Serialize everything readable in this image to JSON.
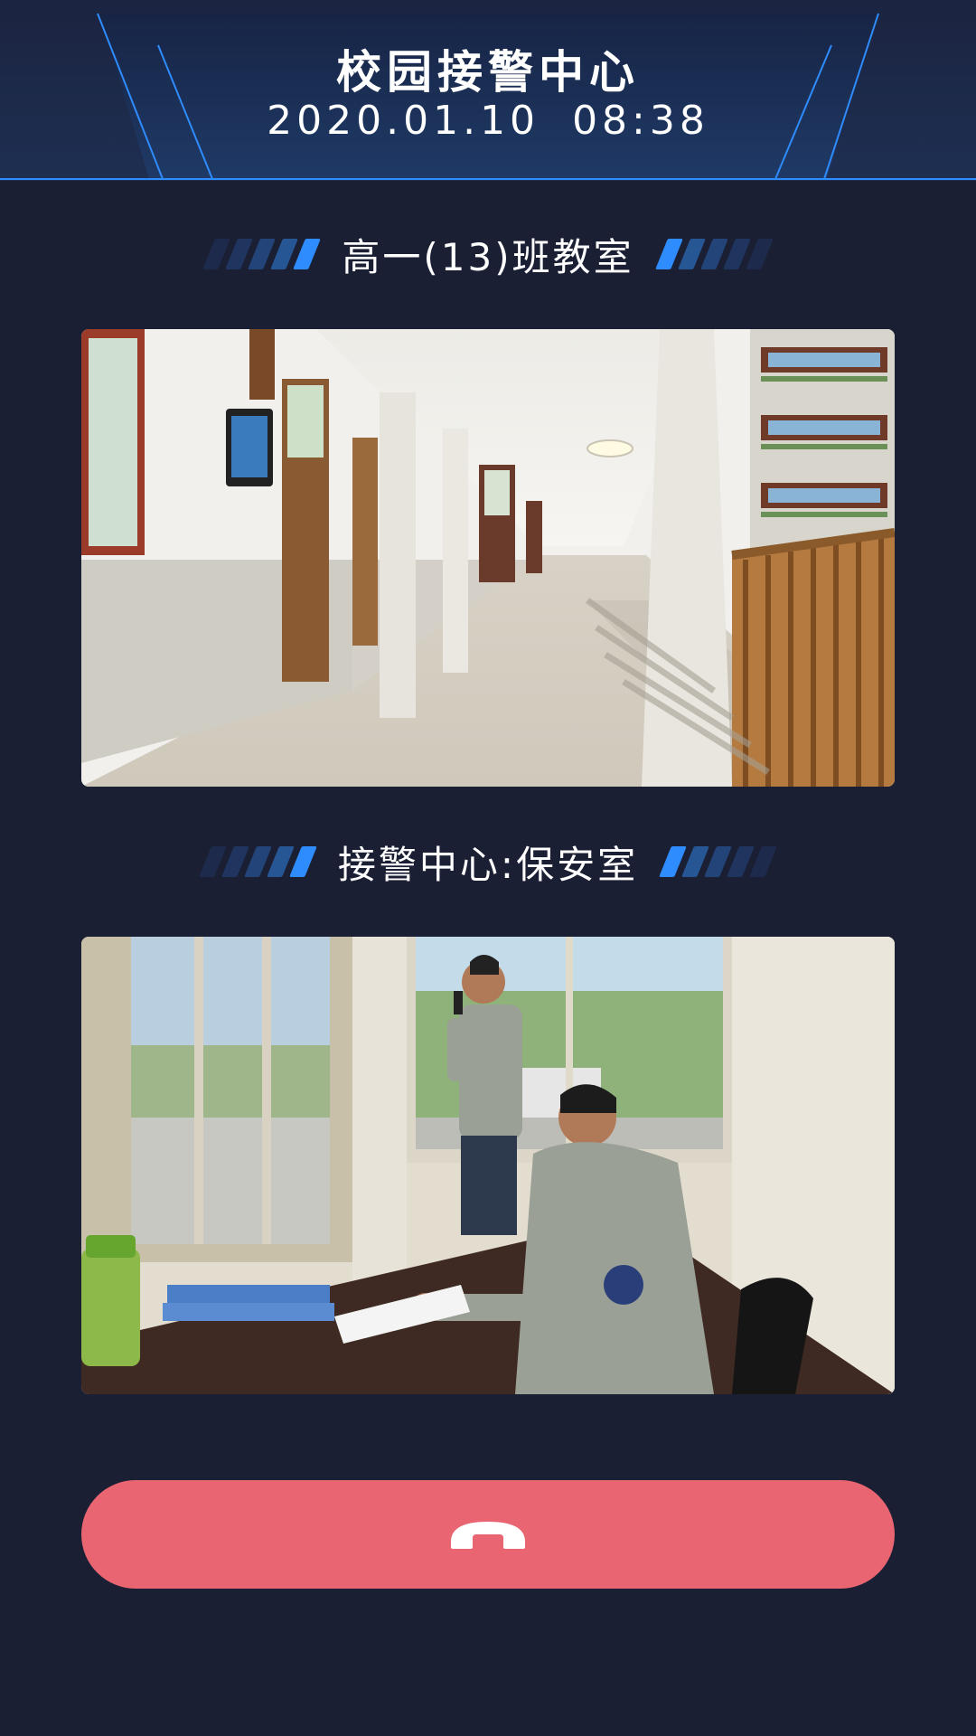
{
  "header": {
    "title": "校园接警中心",
    "date": "2020.01.10",
    "time": "08:38"
  },
  "call_source": {
    "label": "高一(13)班教室",
    "video_description": "corridor-camera-feed"
  },
  "call_receiver": {
    "label": "接警中心:保安室",
    "video_description": "security-room-camera-feed"
  },
  "hangup_button": {
    "icon": "phone-hangup-icon",
    "color": "#e96572"
  },
  "colors": {
    "background": "#1b1f33",
    "accent": "#2f8cff",
    "hangup": "#e96572"
  }
}
